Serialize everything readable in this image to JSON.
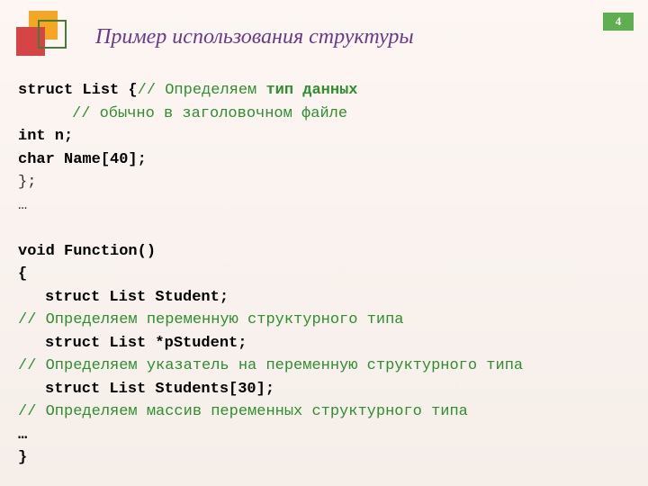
{
  "page_number": "4",
  "title": "Пример использования структуры",
  "code": {
    "l1a": "struct List {",
    "l1b": "// Определяем ",
    "l1c": "тип данных",
    "l2": "// обычно в заголовочном файле",
    "l3": "int n;",
    "l4": "char Name[40];",
    "l5": "};",
    "l6": "…",
    "l7": "void Function()",
    "l8": "{",
    "l9": "struct List Student;",
    "l10": "// Определяем переменную структурного типа",
    "l11": "struct List *pStudent;",
    "l12": "// Определяем указатель на переменную структурного типа",
    "l13": "struct List Students[30];",
    "l14": "// Определяем массив переменных структурного типа",
    "l15": "…",
    "l16": "}"
  }
}
